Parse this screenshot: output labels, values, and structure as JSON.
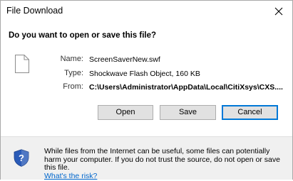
{
  "window": {
    "title": "File Download"
  },
  "dialog": {
    "question": "Do you want to open or save this file?",
    "file": {
      "name_label": "Name:",
      "name_value": "ScreenSaverNew.swf",
      "type_label": "Type:",
      "type_value": "Shockwave Flash Object, 160 KB",
      "from_label": "From:",
      "from_value": "C:\\Users\\Administrator\\AppData\\Local\\CitiXsys\\CXS...."
    },
    "buttons": {
      "open": "Open",
      "save": "Save",
      "cancel": "Cancel"
    },
    "warning": {
      "text": "While files from the Internet can be useful, some files can potentially harm your computer. If you do not trust the source, do not open or save this file.",
      "link": "What's the risk?"
    }
  },
  "icons": {
    "close": "close-icon",
    "file": "file-icon",
    "shield": "shield-question-icon"
  },
  "colors": {
    "link": "#0066cc",
    "default_button_border": "#0078d7",
    "footer_bg": "#f0f0f0",
    "shield_blue": "#2a5bb8"
  }
}
